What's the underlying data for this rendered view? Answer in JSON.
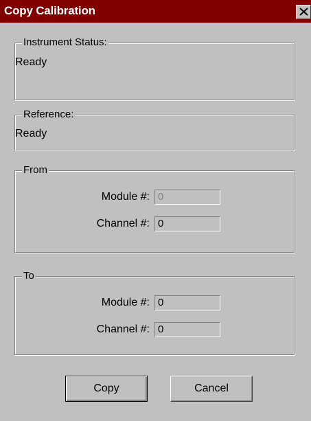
{
  "window": {
    "title": "Copy Calibration"
  },
  "instrument_status": {
    "label": "Instrument Status:",
    "value": "Ready"
  },
  "reference": {
    "label": "Reference:",
    "value": "Ready"
  },
  "from": {
    "label": "From",
    "module_label": "Module #:",
    "module_value": "0",
    "channel_label": "Channel #:",
    "channel_value": "0"
  },
  "to": {
    "label": "To",
    "module_label": "Module #:",
    "module_value": "0",
    "channel_label": "Channel #:",
    "channel_value": "0"
  },
  "buttons": {
    "copy": "Copy",
    "cancel": "Cancel"
  },
  "colors": {
    "titlebar": "#800000",
    "face": "#c0c0c0"
  },
  "icons": {
    "close": "close-icon"
  }
}
